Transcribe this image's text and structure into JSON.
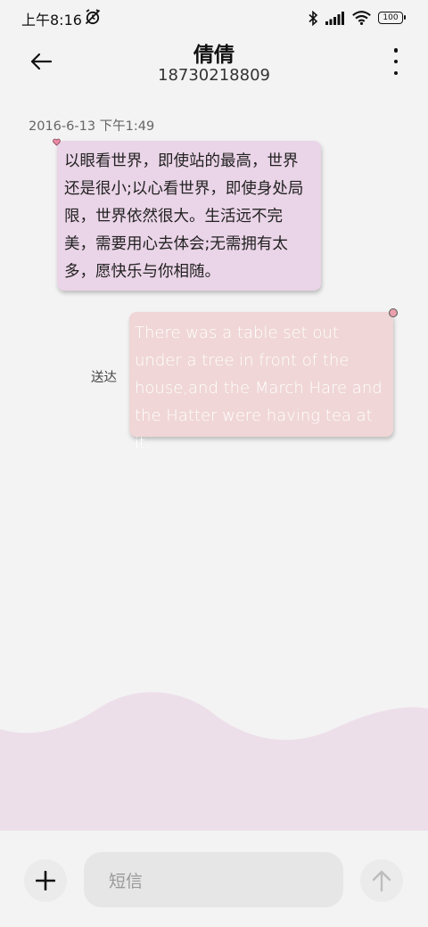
{
  "status_bar": {
    "time": "上午8:16",
    "battery": "100",
    "icons": [
      "alarm-off-icon",
      "bluetooth-icon",
      "signal-icon",
      "wifi-icon",
      "battery-icon"
    ]
  },
  "header": {
    "contact_name": "倩倩",
    "contact_number": "18730218809",
    "icons": [
      "back-arrow-icon",
      "more-vertical-icon"
    ]
  },
  "conversation": {
    "timestamp": "2016-6-13 下午1:49",
    "messages": [
      {
        "direction": "incoming",
        "text": "以眼看世界，即使站的最高，世界还是很小;以心看世界，即使身处局限，世界依然很大。生活远不完美，需要用心去体会;无需拥有太多，愿快乐与你相随。",
        "bubble_color": "#ead4e7"
      },
      {
        "direction": "outgoing",
        "text": "There was a table set out under a tree in front of the house,and the March Hare and the Hatter were having tea at it.",
        "status": "送达",
        "bubble_color": "#f0d6d6"
      }
    ]
  },
  "composer": {
    "placeholder": "短信",
    "icons": [
      "plus-icon",
      "send-arrow-icon"
    ]
  },
  "colors": {
    "background": "#f3f3f3",
    "wave": "#eddfea",
    "incoming_bubble": "#ead4e7",
    "outgoing_bubble": "#f0d6d6"
  }
}
